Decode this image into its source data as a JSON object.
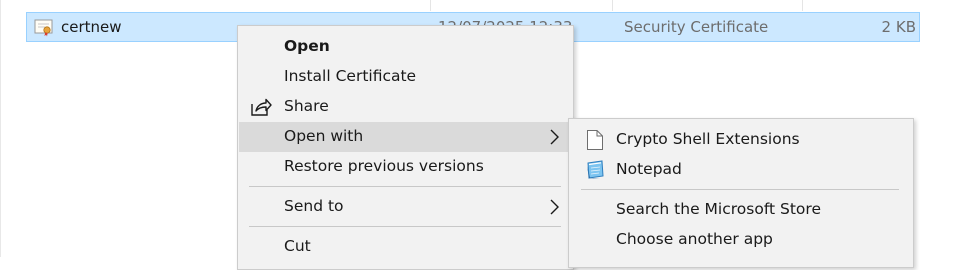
{
  "file": {
    "name": "certnew",
    "date": "12/07/2025 12:33",
    "type": "Security Certificate",
    "size": "2 KB",
    "icon": "certificate-icon"
  },
  "context_menu": {
    "items": [
      {
        "label": "Open",
        "bold": true
      },
      {
        "label": "Install Certificate"
      },
      {
        "label": "Share",
        "icon": "share-icon"
      },
      {
        "label": "Open with",
        "submenu": true
      },
      {
        "label": "Restore previous versions"
      },
      {
        "label": "Send to",
        "submenu": true
      },
      {
        "label": "Cut"
      }
    ]
  },
  "open_with_submenu": {
    "items": [
      {
        "label": "Crypto Shell Extensions",
        "icon": "blank-file-icon"
      },
      {
        "label": "Notepad",
        "icon": "notepad-icon"
      },
      {
        "label": "Search the Microsoft Store"
      },
      {
        "label": "Choose another app"
      }
    ]
  },
  "colors": {
    "selection": "#cce8ff",
    "menu_background": "#f2f2f2",
    "menu_highlight": "#dadada"
  }
}
